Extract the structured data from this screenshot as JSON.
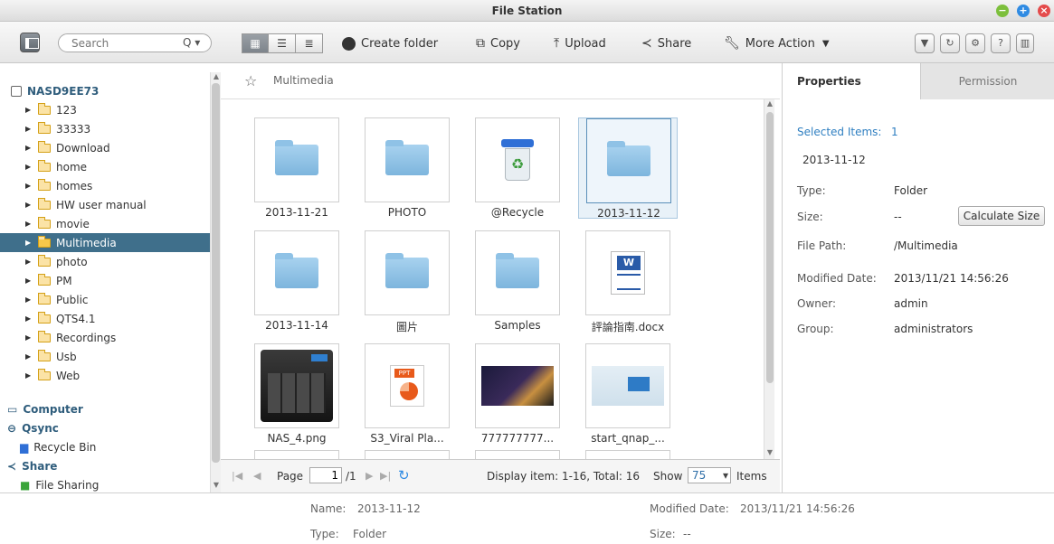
{
  "window": {
    "title": "File Station",
    "controls": {
      "minimize": "−",
      "maximize": "+",
      "close": "×"
    }
  },
  "toolbar": {
    "search_placeholder": "Search",
    "search_icon": "Q ▾",
    "create_folder": "Create folder",
    "copy": "Copy",
    "upload": "Upload",
    "share": "Share",
    "more_action": "More Action",
    "right_buttons": [
      "filter-icon",
      "refresh-icon",
      "settings-icon",
      "help-icon",
      "panel-icon"
    ]
  },
  "tree": {
    "root": "NASD9EE73",
    "folders": [
      "123",
      "33333",
      "Download",
      "home",
      "homes",
      "HW user manual",
      "movie",
      "Multimedia",
      "photo",
      "PM",
      "Public",
      "QTS4.1",
      "Recordings",
      "Usb",
      "Web"
    ],
    "selected": "Multimedia",
    "computer": "Computer",
    "qsync": "Qsync",
    "recycle_bin": "Recycle Bin",
    "share": "Share",
    "file_sharing": "File Sharing"
  },
  "breadcrumb": {
    "path": "Multimedia"
  },
  "files": [
    {
      "name": "2013-11-21",
      "icon": "folder-icon"
    },
    {
      "name": "PHOTO",
      "icon": "folder-icon"
    },
    {
      "name": "@Recycle",
      "icon": "recycle-bin-icon"
    },
    {
      "name": "2013-11-12",
      "icon": "folder-icon",
      "selected": true
    },
    {
      "name": "2013-11-14",
      "icon": "folder-icon"
    },
    {
      "name": "圖片",
      "icon": "folder-icon"
    },
    {
      "name": "Samples",
      "icon": "folder-icon"
    },
    {
      "name": "評論指南.docx",
      "icon": "word-document-icon"
    },
    {
      "name": "NAS_4.png",
      "icon": "nas-image-thumbnail"
    },
    {
      "name": "S3_Viral Pla...",
      "icon": "powerpoint-icon"
    },
    {
      "name": "777777777...",
      "icon": "photo-thumbnail"
    },
    {
      "name": "start_qnap_...",
      "icon": "webpage-thumbnail"
    }
  ],
  "pager": {
    "page_label": "Page",
    "page_value": "1",
    "page_total": "/1",
    "display": "Display item: 1-16, Total: 16",
    "show_label": "Show",
    "show_value": "75",
    "items_label": "Items"
  },
  "properties": {
    "tab_properties": "Properties",
    "tab_permission": "Permission",
    "selected_items_label": "Selected Items:",
    "selected_items_count": "1",
    "selected_name": "2013-11-12",
    "type_label": "Type:",
    "type_value": "Folder",
    "size_label": "Size:",
    "size_value": "--",
    "calc_button": "Calculate Size",
    "path_label": "File Path:",
    "path_value": "/Multimedia",
    "modified_label": "Modified Date:",
    "modified_value": "2013/11/21 14:56:26",
    "owner_label": "Owner:",
    "owner_value": "admin",
    "group_label": "Group:",
    "group_value": "administrators"
  },
  "bottom": {
    "name_label": "Name:",
    "name_value": "2013-11-12",
    "modified_label": "Modified Date:",
    "modified_value": "2013/11/21 14:56:26",
    "type_label": "Type:",
    "type_value": "Folder",
    "size_label": "Size:",
    "size_value": "--"
  }
}
